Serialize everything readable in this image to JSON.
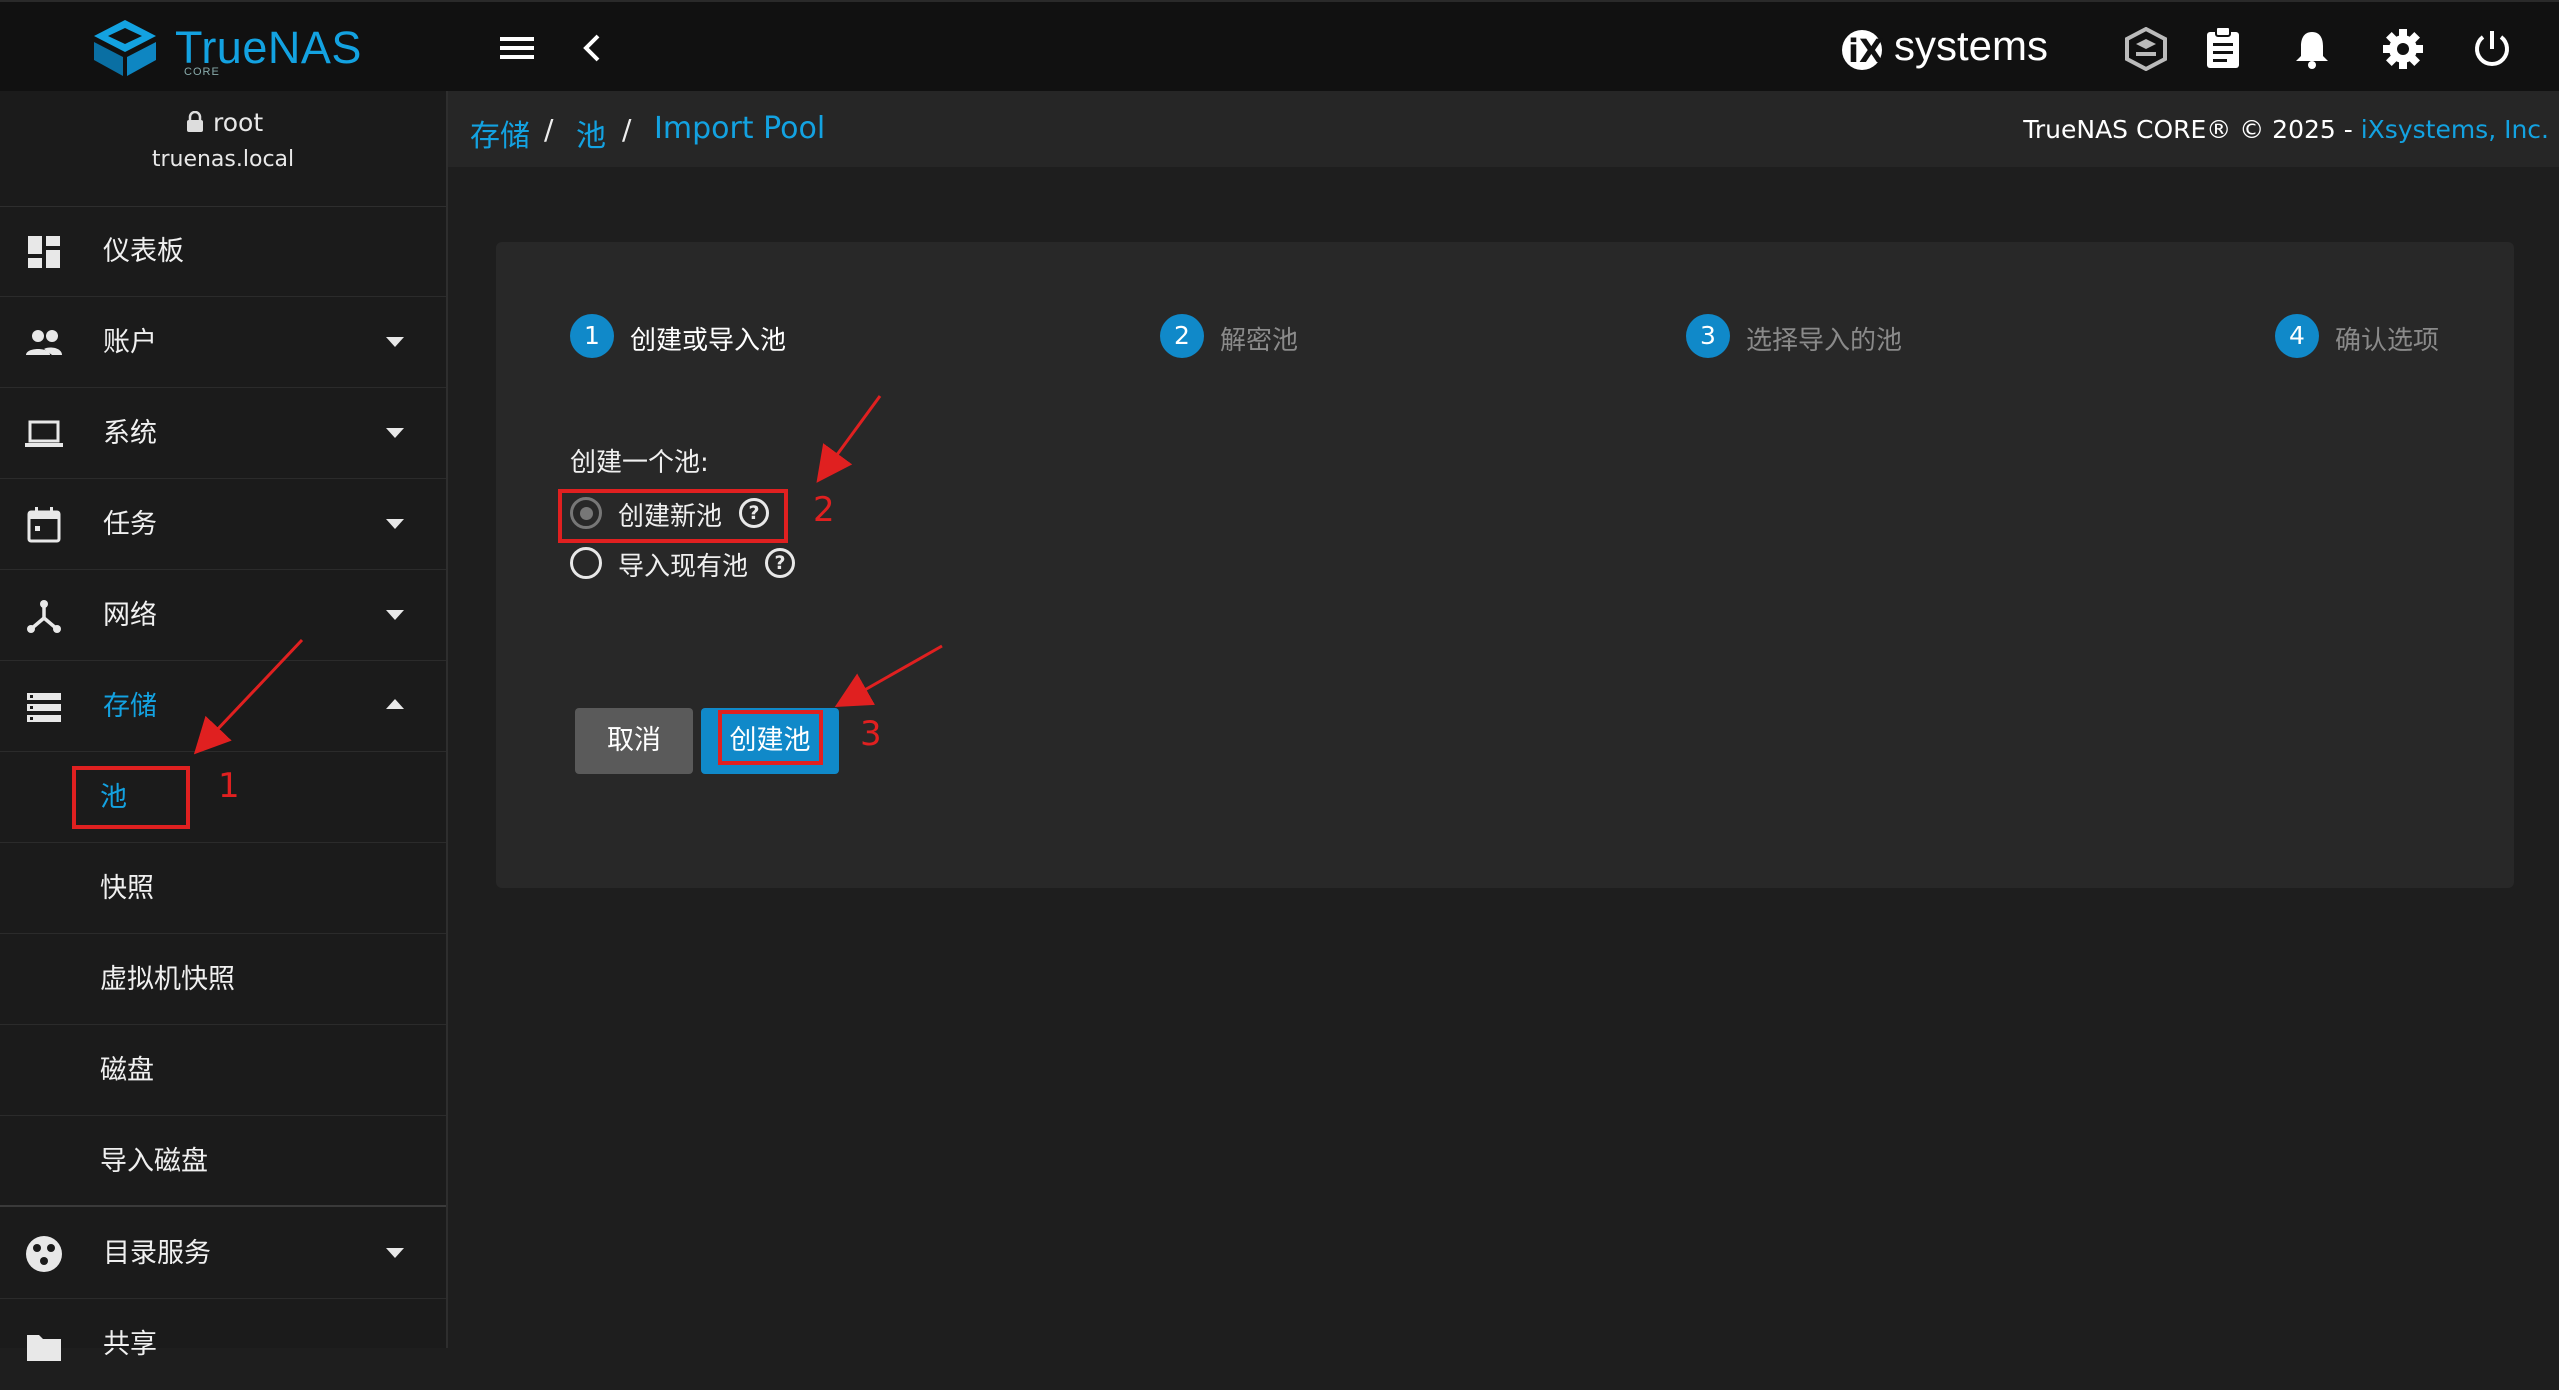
{
  "header": {
    "logo_text": "TrueNAS",
    "logo_sub": "CORE",
    "vendor_logo": "iXsystems",
    "icons": [
      "menu-icon",
      "back-chevron-icon",
      "truecommand-icon",
      "task-manager-icon",
      "notifications-bell-icon",
      "settings-gear-icon",
      "power-icon"
    ]
  },
  "user": {
    "name": "root",
    "host": "truenas.local"
  },
  "sidebar": {
    "items": [
      {
        "label": "仪表板",
        "icon": "dashboard-icon"
      },
      {
        "label": "账户",
        "icon": "accounts-icon"
      },
      {
        "label": "系统",
        "icon": "system-laptop-icon"
      },
      {
        "label": "任务",
        "icon": "tasks-calendar-icon"
      },
      {
        "label": "网络",
        "icon": "network-icon"
      },
      {
        "label": "存储",
        "icon": "storage-icon"
      }
    ],
    "storage_sub": [
      "池",
      "快照",
      "虚拟机快照",
      "磁盘",
      "导入磁盘"
    ],
    "directory_services": "目录服务",
    "partial_item": "共享"
  },
  "breadcrumb": {
    "items": [
      "存储",
      "池",
      "Import Pool"
    ],
    "separator": "/"
  },
  "copyright": {
    "text": "TrueNAS CORE® © 2025 - ",
    "link": "iXsystems, Inc."
  },
  "wizard": {
    "steps": [
      {
        "num": "1",
        "label": "创建或导入池"
      },
      {
        "num": "2",
        "label": "解密池"
      },
      {
        "num": "3",
        "label": "选择导入的池"
      },
      {
        "num": "4",
        "label": "确认选项"
      }
    ],
    "question": "创建一个池:",
    "options": [
      "创建新池",
      "导入现有池"
    ],
    "selected_option": "创建新池",
    "help_glyph": "?",
    "cancel_label": "取消",
    "create_label": "创建池"
  },
  "annotations": {
    "labels": [
      "1",
      "2",
      "3"
    ],
    "color": "#e02020"
  },
  "colors": {
    "accent": "#13a2e1",
    "primary_button": "#1089c9",
    "cancel_button": "#5a5a5a"
  }
}
